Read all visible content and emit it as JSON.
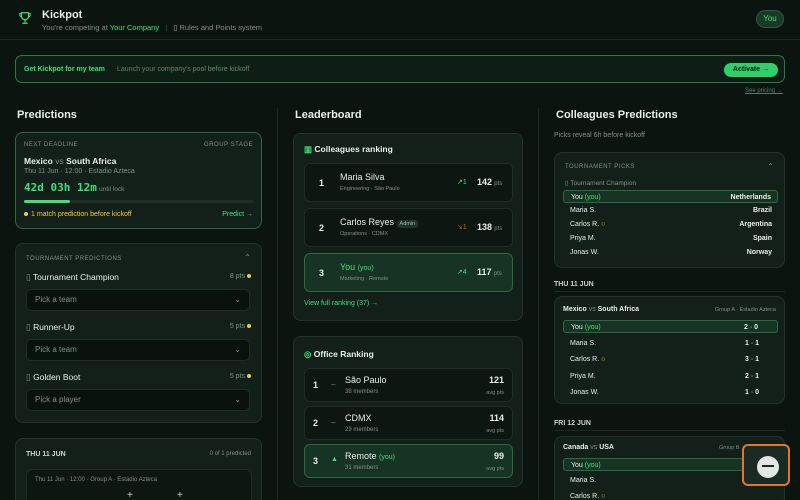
{
  "header": {
    "title": "Kickpot",
    "competing_prefix": "You're competing at",
    "company": "Your Company",
    "rules_link": "Rules and Points system",
    "user_button": "You"
  },
  "banner": {
    "title": "Get Kickpot for my team",
    "text": "Launch your company's pool before kickoff",
    "cta": "Activate →",
    "pricing_link": "See pricing →"
  },
  "predictions": {
    "title": "Predictions",
    "deadline": {
      "label": "NEXT DEADLINE",
      "stage": "GROUP STAGE",
      "home": "Mexico",
      "vs": "vs",
      "away": "South Africa",
      "details": "Thu 11 Jun · 12:00 · Estadio Azteca",
      "countdown": "42d 03h 12m",
      "until": "until lock",
      "progress": 0.2,
      "note": "1 match prediction before kickoff",
      "predict": "Predict →"
    },
    "tournament": {
      "label": "TOURNAMENT PREDICTIONS",
      "items": [
        {
          "name": "Tournament Champion",
          "pts": "8 pts",
          "placeholder": "Pick a team"
        },
        {
          "name": "Runner-Up",
          "pts": "5 pts",
          "placeholder": "Pick a team"
        },
        {
          "name": "Golden Boot",
          "pts": "5 pts",
          "placeholder": "Pick a player"
        }
      ]
    },
    "day": {
      "label": "THU 11 JUN",
      "count": "0 of 1 predicted",
      "match": "Thu 11 Jun · 12:00 · Group A · Estadio Azteca"
    }
  },
  "leaderboard": {
    "title": "Leaderboard",
    "colleagues": {
      "label": "Colleagues ranking",
      "rows": [
        {
          "rank": "1",
          "name": "Maria Silva",
          "badge": "",
          "meta": "Engineering · São Paulo",
          "delta": "1",
          "dir": "up",
          "pts": "142"
        },
        {
          "rank": "2",
          "name": "Carlos Reyes",
          "badge": "Admin",
          "meta": "Operations · CDMX",
          "delta": "1",
          "dir": "down",
          "pts": "138"
        },
        {
          "rank": "3",
          "name": "You",
          "you": "(you)",
          "badge": "",
          "meta": "Marketing · Remote",
          "delta": "4",
          "dir": "up",
          "pts": "117"
        }
      ],
      "pts_unit": "pts",
      "view_full": "View full ranking (37) →"
    },
    "office": {
      "label": "Office Ranking",
      "rows": [
        {
          "rank": "1",
          "mark": "–",
          "name": "São Paulo",
          "you": "",
          "members": "38 members",
          "pts": "121",
          "unit": "avg pts"
        },
        {
          "rank": "2",
          "mark": "–",
          "name": "CDMX",
          "you": "",
          "members": "29 members",
          "pts": "114",
          "unit": "avg pts"
        },
        {
          "rank": "3",
          "mark": "▲",
          "name": "Remote",
          "you": "(you)",
          "members": "31 members",
          "pts": "99",
          "unit": "avg pts"
        }
      ]
    }
  },
  "colleagues_predictions": {
    "title": "Colleagues Predictions",
    "subtitle": "Picks reveal 6h before kickoff",
    "tournament": {
      "label": "TOURNAMENT PICKS",
      "sub": "Tournament Champion",
      "rows": [
        {
          "name": "You",
          "you": "(you)",
          "pick": "Netherlands"
        },
        {
          "name": "Maria S.",
          "you": "",
          "pick": "Brazil"
        },
        {
          "name": "Carlos R.",
          "you": "",
          "pick": "Argentina"
        },
        {
          "name": "Priya M.",
          "you": "",
          "pick": "Spain"
        },
        {
          "name": "Jonas W.",
          "you": "",
          "pick": "Norway"
        }
      ]
    },
    "day1": {
      "label": "THU 11 JUN",
      "home": "Mexico",
      "vs": "vs",
      "away": "South Africa",
      "meta": "Group A · Estadio Azteca",
      "rows": [
        {
          "name": "You",
          "you": "(you)",
          "h": "2",
          "a": "0"
        },
        {
          "name": "Maria S.",
          "you": "",
          "h": "1",
          "a": "1"
        },
        {
          "name": "Carlos R.",
          "you": "",
          "h": "3",
          "a": "1"
        },
        {
          "name": "Priya M.",
          "you": "",
          "h": "2",
          "a": "1"
        },
        {
          "name": "Jonas W.",
          "you": "",
          "h": "1",
          "a": "0"
        }
      ]
    },
    "day2": {
      "label": "FRI 12 JUN",
      "home": "Canada",
      "vs": "vs",
      "away": "USA",
      "meta": "Group B",
      "rows": [
        {
          "name": "You",
          "you": "(you)",
          "h": "1",
          "a": "0"
        },
        {
          "name": "Maria S.",
          "you": "",
          "h": "",
          "a": ""
        },
        {
          "name": "Carlos R.",
          "you": "",
          "h": "",
          "a": ""
        }
      ]
    }
  }
}
